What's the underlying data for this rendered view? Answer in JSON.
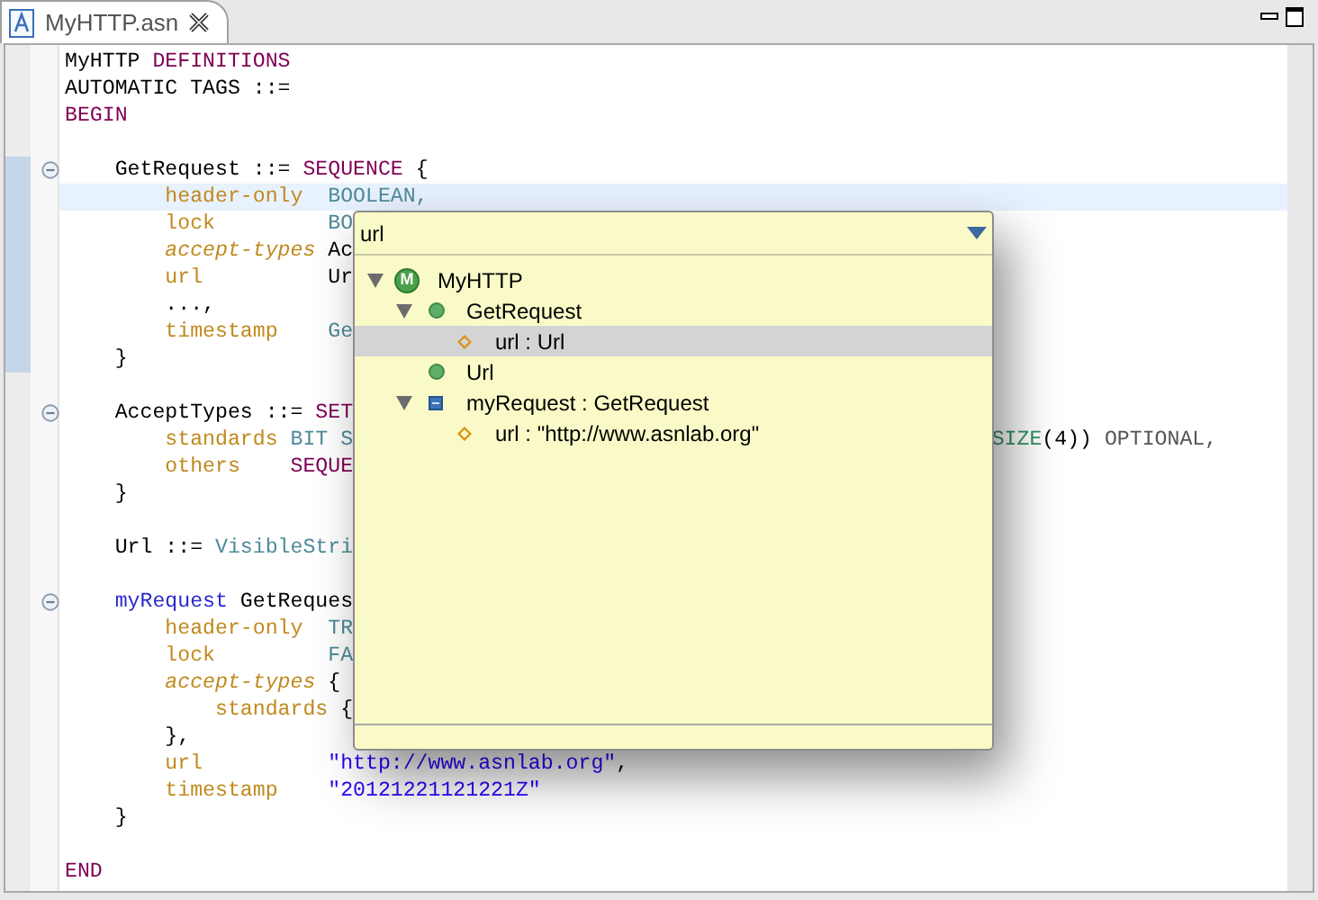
{
  "tab": {
    "title": "MyHTTP.asn",
    "selected": true
  },
  "editor": {
    "lines": [
      {
        "current": false,
        "foldable": false,
        "blank_before": false,
        "tokens": [
          {
            "t": "MyHTTP ",
            "kind": "plain"
          },
          {
            "t": "DEFINITIONS",
            "kind": "keyword"
          }
        ]
      },
      {
        "current": false,
        "foldable": false,
        "blank_before": false,
        "tokens": [
          {
            "t": "AUTOMATIC TAGS ::=",
            "kind": "plain"
          }
        ]
      },
      {
        "current": false,
        "foldable": false,
        "blank_before": false,
        "tokens": [
          {
            "t": "BEGIN",
            "kind": "keyword"
          }
        ]
      },
      {
        "current": false,
        "foldable": true,
        "blank_before": true,
        "tokens": [
          {
            "t": "    GetRequest ::= ",
            "kind": "plain"
          },
          {
            "t": "SEQUENCE",
            "kind": "keyword"
          },
          {
            "t": " {",
            "kind": "plain"
          }
        ]
      },
      {
        "current": true,
        "foldable": false,
        "blank_before": false,
        "tokens": [
          {
            "t": "        header-only  ",
            "kind": "field"
          },
          {
            "t": "BOOLEAN,",
            "kind": "type"
          }
        ]
      },
      {
        "current": false,
        "foldable": false,
        "blank_before": false,
        "tokens": [
          {
            "t": "        lock         ",
            "kind": "field"
          },
          {
            "t": "BO",
            "kind": "type"
          }
        ]
      },
      {
        "current": false,
        "foldable": false,
        "blank_before": false,
        "tokens": [
          {
            "t": "        accept-types ",
            "kind": "field_italic"
          },
          {
            "t": "Ac",
            "kind": "plain"
          }
        ]
      },
      {
        "current": false,
        "foldable": false,
        "blank_before": false,
        "tokens": [
          {
            "t": "        url          ",
            "kind": "field"
          },
          {
            "t": "Ur",
            "kind": "plain"
          }
        ]
      },
      {
        "current": false,
        "foldable": false,
        "blank_before": false,
        "tokens": [
          {
            "t": "        ...,",
            "kind": "plain"
          }
        ]
      },
      {
        "current": false,
        "foldable": false,
        "blank_before": false,
        "tokens": [
          {
            "t": "        timestamp    ",
            "kind": "field"
          },
          {
            "t": "Ge",
            "kind": "type"
          }
        ]
      },
      {
        "current": false,
        "foldable": false,
        "blank_before": false,
        "tokens": [
          {
            "t": "    }",
            "kind": "plain"
          }
        ]
      },
      {
        "current": false,
        "foldable": true,
        "blank_before": true,
        "tokens": [
          {
            "t": "    AcceptTypes ::= ",
            "kind": "plain"
          },
          {
            "t": "SET",
            "kind": "keyword"
          }
        ]
      },
      {
        "current": false,
        "foldable": false,
        "blank_before": false,
        "tokens": [
          {
            "t": "        standards ",
            "kind": "field"
          },
          {
            "t": "BIT S",
            "kind": "type"
          }
        ],
        "right_tokens": [
          {
            "t": "SIZE",
            "kind": "size"
          },
          {
            "t": "(4)) ",
            "kind": "plain"
          },
          {
            "t": "OPTIONAL,",
            "kind": "optional"
          }
        ]
      },
      {
        "current": false,
        "foldable": false,
        "blank_before": false,
        "tokens": [
          {
            "t": "        others    ",
            "kind": "field"
          },
          {
            "t": "SEQUE",
            "kind": "keyword"
          }
        ]
      },
      {
        "current": false,
        "foldable": false,
        "blank_before": false,
        "tokens": [
          {
            "t": "    }",
            "kind": "plain"
          }
        ]
      },
      {
        "current": false,
        "foldable": false,
        "blank_before": true,
        "tokens": [
          {
            "t": "    Url ::= ",
            "kind": "plain"
          },
          {
            "t": "VisibleStri",
            "kind": "type"
          }
        ]
      },
      {
        "current": false,
        "foldable": true,
        "blank_before": true,
        "tokens": [
          {
            "t": "    myRequest",
            "kind": "value"
          },
          {
            "t": " GetReques",
            "kind": "plain"
          }
        ]
      },
      {
        "current": false,
        "foldable": false,
        "blank_before": false,
        "tokens": [
          {
            "t": "        header-only  ",
            "kind": "field"
          },
          {
            "t": "TR",
            "kind": "type"
          }
        ]
      },
      {
        "current": false,
        "foldable": false,
        "blank_before": false,
        "tokens": [
          {
            "t": "        lock         ",
            "kind": "field"
          },
          {
            "t": "FA",
            "kind": "type"
          }
        ]
      },
      {
        "current": false,
        "foldable": false,
        "blank_before": false,
        "tokens": [
          {
            "t": "        accept-types ",
            "kind": "field_italic"
          },
          {
            "t": "{",
            "kind": "plain"
          }
        ]
      },
      {
        "current": false,
        "foldable": false,
        "blank_before": false,
        "tokens": [
          {
            "t": "            standards ",
            "kind": "field"
          },
          {
            "t": "{",
            "kind": "plain"
          }
        ]
      },
      {
        "current": false,
        "foldable": false,
        "blank_before": false,
        "tokens": [
          {
            "t": "        },",
            "kind": "plain"
          }
        ]
      },
      {
        "current": false,
        "foldable": false,
        "blank_before": false,
        "tokens": [
          {
            "t": "        url          ",
            "kind": "field"
          },
          {
            "t": "\"http://www.asnlab.org\"",
            "kind": "string"
          },
          {
            "t": ",",
            "kind": "plain"
          }
        ]
      },
      {
        "current": false,
        "foldable": false,
        "blank_before": false,
        "tokens": [
          {
            "t": "        timestamp    ",
            "kind": "field"
          },
          {
            "t": "\"20121221121221Z\"",
            "kind": "string"
          }
        ]
      },
      {
        "current": false,
        "foldable": false,
        "blank_before": false,
        "tokens": [
          {
            "t": "    }",
            "kind": "plain"
          }
        ]
      },
      {
        "current": false,
        "foldable": false,
        "blank_before": true,
        "tokens": [
          {
            "t": "END",
            "kind": "keyword"
          }
        ]
      }
    ]
  },
  "quick_outline": {
    "filter": "url",
    "tree": [
      {
        "label": "MyHTTP",
        "kind": "module",
        "badge": "M",
        "expanded": true,
        "selected": false,
        "children": [
          {
            "label": "GetRequest",
            "kind": "type",
            "expanded": true,
            "selected": false,
            "children": [
              {
                "label": "url : Url",
                "kind": "field",
                "selected": true
              }
            ]
          },
          {
            "label": "Url",
            "kind": "type",
            "selected": false
          },
          {
            "label": "myRequest : GetRequest",
            "kind": "value",
            "expanded": true,
            "selected": false,
            "children": [
              {
                "label": "url : \"http://www.asnlab.org\"",
                "kind": "field",
                "selected": false
              }
            ]
          }
        ]
      }
    ]
  }
}
